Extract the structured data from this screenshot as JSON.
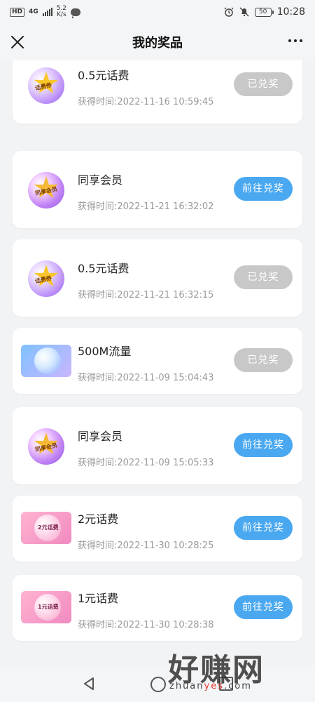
{
  "status_bar": {
    "hd_label": "HD",
    "network_type": "4G",
    "net_speed_value": "5.2",
    "net_speed_unit": "K/s",
    "battery": "50",
    "time": "10:28"
  },
  "header": {
    "title": "我的奖品"
  },
  "prizes": [
    {
      "name": "0.5元话费",
      "time": "获得时间:2022-11-16 10:59:45",
      "button": "已兑奖",
      "state": "redeemed",
      "icon": "coupon-ball-icon",
      "icon_label": "话费券"
    },
    {
      "name": "同享会员",
      "time": "获得时间:2022-11-21 16:32:02",
      "button": "前往兑奖",
      "state": "available",
      "icon": "member-ball-icon",
      "icon_label": "同享会员"
    },
    {
      "name": "0.5元话费",
      "time": "获得时间:2022-11-21 16:32:15",
      "button": "已兑奖",
      "state": "redeemed",
      "icon": "coupon-ball-icon",
      "icon_label": "话费券"
    },
    {
      "name": "500M流量",
      "time": "获得时间:2022-11-09 15:04:43",
      "button": "已兑奖",
      "state": "redeemed",
      "icon": "data-flow-icon",
      "icon_label": ""
    },
    {
      "name": "同享会员",
      "time": "获得时间:2022-11-09 15:05:33",
      "button": "前往兑奖",
      "state": "available",
      "icon": "member-ball-icon",
      "icon_label": "同享会员"
    },
    {
      "name": "2元话费",
      "time": "获得时间:2022-11-30 10:28:25",
      "button": "前往兑奖",
      "state": "available",
      "icon": "pink-coupon-icon",
      "icon_label": "2元话费"
    },
    {
      "name": "1元话费",
      "time": "获得时间:2022-11-30 10:28:38",
      "button": "前往兑奖",
      "state": "available",
      "icon": "pink-coupon-icon",
      "icon_label": "1元话费"
    }
  ],
  "colors": {
    "redeemed_button": "#c8c8c8",
    "available_button": "#4aa8f0",
    "page_background": "#f2f3f5"
  },
  "watermark": {
    "big": "好赚网",
    "small_prefix": "zhuan",
    "small_highlight": "yes",
    "small_suffix": ".com"
  }
}
